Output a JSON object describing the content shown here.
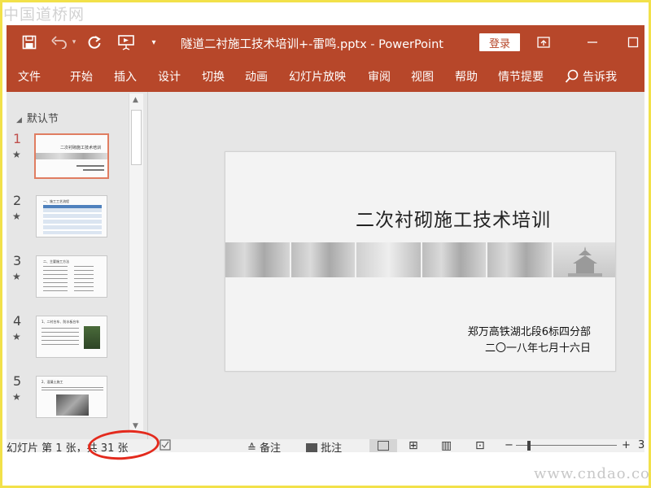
{
  "watermark_top": "中国道桥网",
  "watermark_bottom": "www.cndao.com",
  "titlebar": {
    "doc_title": "隧道二衬施工技术培训+-雷鸣.pptx - PowerPoint",
    "login_label": "登录",
    "qa_dropdown": "▾"
  },
  "ribbon": {
    "tabs": [
      "文件",
      "开始",
      "插入",
      "设计",
      "切换",
      "动画",
      "幻灯片放映",
      "审阅",
      "视图",
      "帮助",
      "情节提要"
    ],
    "tell_me": "告诉我"
  },
  "panel": {
    "section": "默认节",
    "slides": [
      {
        "num": "1",
        "star": "★",
        "thumb_title": "二次衬砌施工技术培训"
      },
      {
        "num": "2",
        "star": "★",
        "thumb_title": "一、施工工艺流程"
      },
      {
        "num": "3",
        "star": "★",
        "thumb_title": "二、主要施工方法"
      },
      {
        "num": "4",
        "star": "★",
        "thumb_title": "1、二衬台车、防水板台车"
      },
      {
        "num": "5",
        "star": "★",
        "thumb_title": "2、混凝土施工"
      }
    ]
  },
  "slide": {
    "title": "二次衬砌施工技术培训",
    "sub1": "郑万高铁湖北段6标四分部",
    "sub2": "二〇一八年七月十六日"
  },
  "status": {
    "slide_info": "幻灯片 第 1 张，共 31 张",
    "notes": "备注",
    "comments": "批注",
    "zoom_minus": "−",
    "zoom_plus": "+",
    "zoom_level": "3"
  },
  "colors": {
    "accent": "#b7472a",
    "highlight": "#e32a1d"
  }
}
